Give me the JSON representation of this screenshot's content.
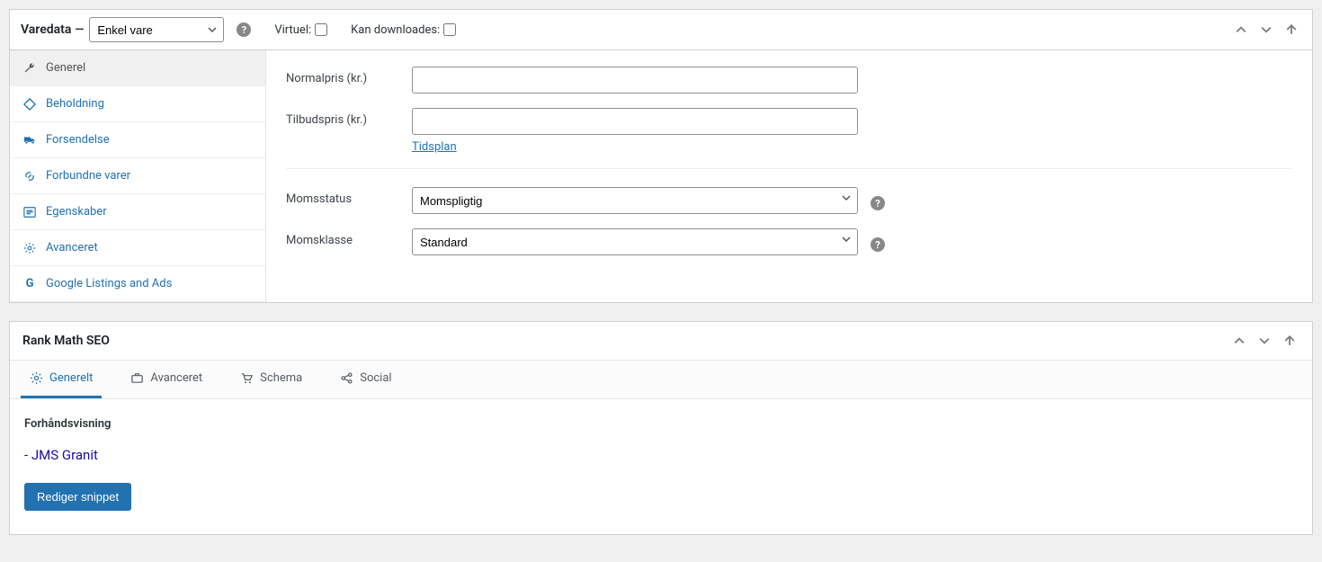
{
  "product_data": {
    "title": "Varedata",
    "product_type_selected": "Enkel vare",
    "virtual_label": "Virtuel:",
    "downloadable_label": "Kan downloades:",
    "tabs": [
      {
        "label": "Generel",
        "icon": "wrench"
      },
      {
        "label": "Beholdning",
        "icon": "diamond"
      },
      {
        "label": "Forsendelse",
        "icon": "truck"
      },
      {
        "label": "Forbundne varer",
        "icon": "link"
      },
      {
        "label": "Egenskaber",
        "icon": "list"
      },
      {
        "label": "Avanceret",
        "icon": "gear"
      },
      {
        "label": "Google Listings and Ads",
        "icon": "g"
      }
    ],
    "fields": {
      "regular_price_label": "Normalpris (kr.)",
      "regular_price_value": "",
      "sale_price_label": "Tilbudspris (kr.)",
      "sale_price_value": "",
      "schedule_label": "Tidsplan",
      "tax_status_label": "Momsstatus",
      "tax_status_value": "Momspligtig",
      "tax_class_label": "Momsklasse",
      "tax_class_value": "Standard"
    }
  },
  "rank_math": {
    "title": "Rank Math SEO",
    "tabs": [
      {
        "label": "Generelt",
        "icon": "gear"
      },
      {
        "label": "Avanceret",
        "icon": "briefcase"
      },
      {
        "label": "Schema",
        "icon": "cart"
      },
      {
        "label": "Social",
        "icon": "share"
      }
    ],
    "preview_label": "Forhåndsvisning",
    "preview_title": "- JMS Granit",
    "edit_button": "Rediger snippet"
  }
}
